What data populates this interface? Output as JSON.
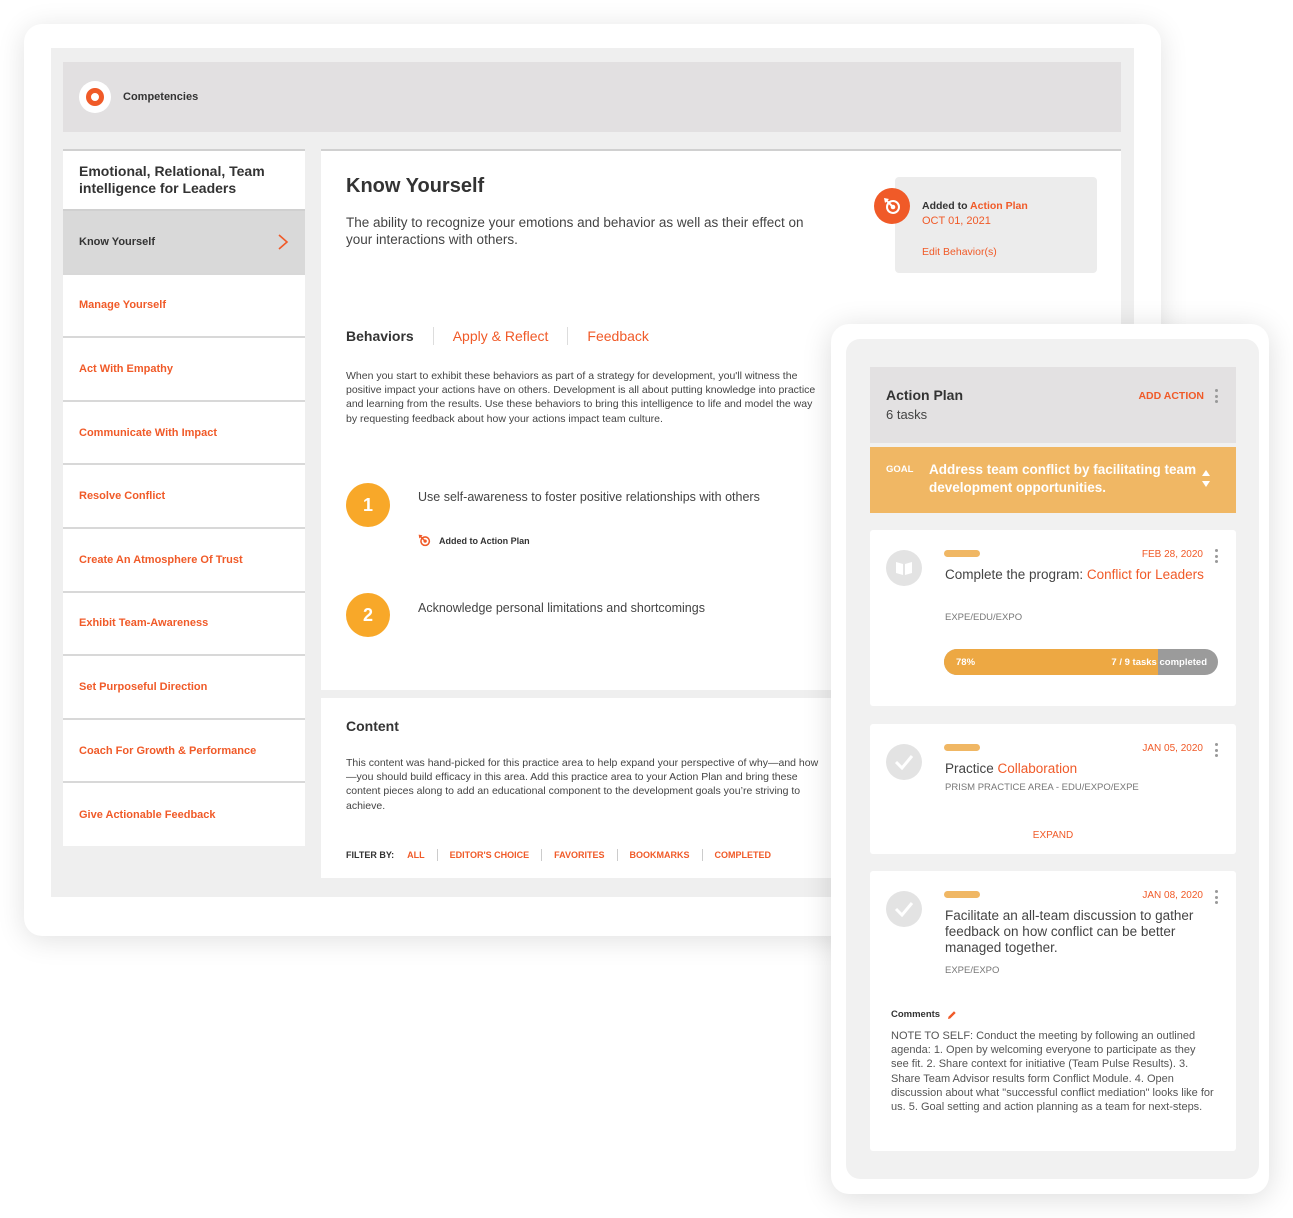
{
  "app": {
    "title": "Competencies"
  },
  "sidebar": {
    "title": "Emotional, Relational, Team intelligence for Leaders",
    "items": [
      {
        "label": "Know Yourself",
        "active": true
      },
      {
        "label": "Manage Yourself"
      },
      {
        "label": "Act With Empathy"
      },
      {
        "label": "Communicate With Impact"
      },
      {
        "label": "Resolve Conflict"
      },
      {
        "label": "Create An Atmosphere Of Trust"
      },
      {
        "label": "Exhibit Team-Awareness"
      },
      {
        "label": "Set Purposeful Direction"
      },
      {
        "label": "Coach For Growth & Performance"
      },
      {
        "label": "Give Actionable Feedback"
      }
    ]
  },
  "main": {
    "title": "Know Yourself",
    "description": "The ability to recognize your emotions and behavior as well as their effect on your interactions with others.",
    "added": {
      "prefix": "Added to ",
      "link": "Action Plan",
      "date": "OCT 01, 2021",
      "edit_label": "Edit Behavior(s)"
    },
    "tabs": [
      {
        "label": "Behaviors",
        "active": true
      },
      {
        "label": "Apply & Reflect"
      },
      {
        "label": "Feedback"
      }
    ],
    "behaviors_description": "When you start to exhibit these behaviors as part of a strategy for development, you'll witness the positive impact your actions have on others. Development is all about putting knowledge into practice and learning from the results. Use these behaviors to bring this intelligence to life and model the way by requesting feedback about how your actions impact team culture.",
    "behaviors": [
      {
        "number": "1",
        "text": "Use self-awareness to foster positive relationships with others",
        "status": "Added to Action Plan"
      },
      {
        "number": "2",
        "text": "Acknowledge personal limitations and shortcomings"
      }
    ]
  },
  "content": {
    "title": "Content",
    "description": "This content was hand-picked for this practice area to help expand your perspective of why—and how—you should build efficacy in this area. Add this practice area to your Action Plan and bring these content pieces along to add an educational component to the development goals you’re striving to achieve.",
    "filter_label": "FILTER BY:",
    "filters": [
      "ALL",
      "EDITOR'S CHOICE",
      "FAVORITES",
      "BOOKMARKS",
      "COMPLETED"
    ]
  },
  "action_plan": {
    "title": "Action Plan",
    "count": "6 tasks",
    "add_label": "ADD ACTION",
    "goal": {
      "label": "GOAL",
      "text": "Address team conflict by facilitating team development opportunities."
    },
    "tasks": [
      {
        "icon": "book-icon",
        "date": "FEB 28, 2020",
        "title_prefix": "Complete the program: ",
        "title_link": "Conflict for Leaders",
        "subtitle": "EXPE/EDU/EXPO",
        "progress_percent": 78,
        "progress_label": "78%",
        "progress_tasks": "7 / 9 tasks completed"
      },
      {
        "icon": "check-icon",
        "date": "JAN 05, 2020",
        "title_prefix": "Practice ",
        "title_link": "Collaboration",
        "subtitle": "PRISM PRACTICE AREA - EDU/EXPO/EXPE",
        "expand_label": "EXPAND"
      },
      {
        "icon": "check-icon",
        "date": "JAN 08, 2020",
        "title_prefix": "Facilitate an all-team discussion to gather feedback on how conflict can be better managed together.",
        "subtitle": "EXPE/EXPO",
        "comments_label": "Comments",
        "comments_text": "NOTE TO SELF: Conduct the meeting by following an outlined agenda: 1. Open by welcoming everyone to participate as they see fit. 2. Share context for initiative (Team Pulse Results). 3. Share Team Advisor results form Conflict Module. 4. Open discussion about what \"successful conflict mediation\" looks like for us. 5. Goal setting and action planning as a team for next-steps."
      }
    ]
  },
  "colors": {
    "accent": "#f05a28",
    "goal": "#f0b764",
    "step": "#f8a829",
    "progress_fill": "#eda843",
    "progress_track": "#9b9b9b"
  }
}
